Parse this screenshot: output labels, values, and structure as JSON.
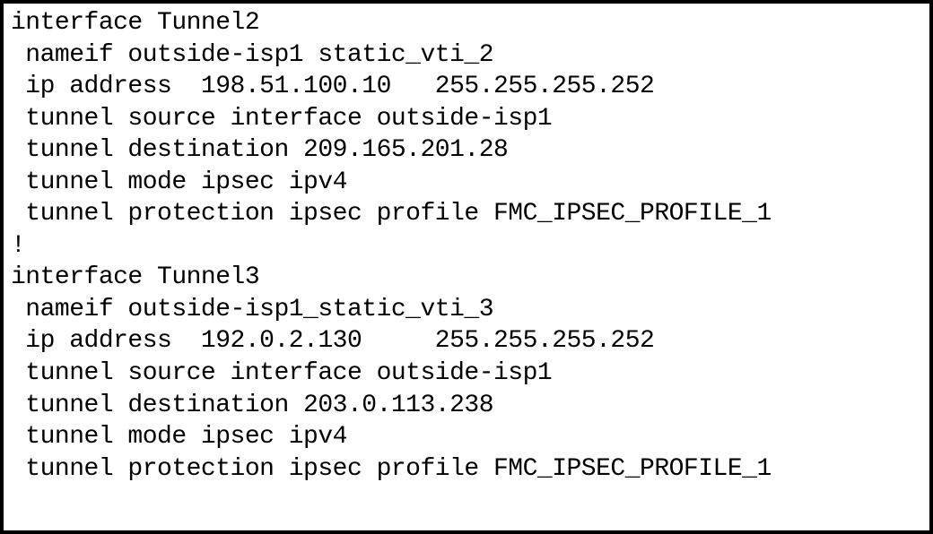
{
  "interfaces": [
    {
      "header": "interface Tunnel2",
      "nameif": " nameif outside-isp1 static_vti_2",
      "ip": " ip address  198.51.100.10   255.255.255.252",
      "source": " tunnel source interface outside-isp1",
      "destination": " tunnel destination 209.165.201.28",
      "mode": " tunnel mode ipsec ipv4",
      "protection": " tunnel protection ipsec profile FMC_IPSEC_PROFILE_1"
    },
    {
      "header": "interface Tunnel3",
      "nameif": " nameif outside-isp1_static_vti_3",
      "ip": " ip address  192.0.2.130     255.255.255.252",
      "source": " tunnel source interface outside-isp1",
      "destination": " tunnel destination 203.0.113.238",
      "mode": " tunnel mode ipsec ipv4",
      "protection": " tunnel protection ipsec profile FMC_IPSEC_PROFILE_1"
    }
  ],
  "separator": "!"
}
